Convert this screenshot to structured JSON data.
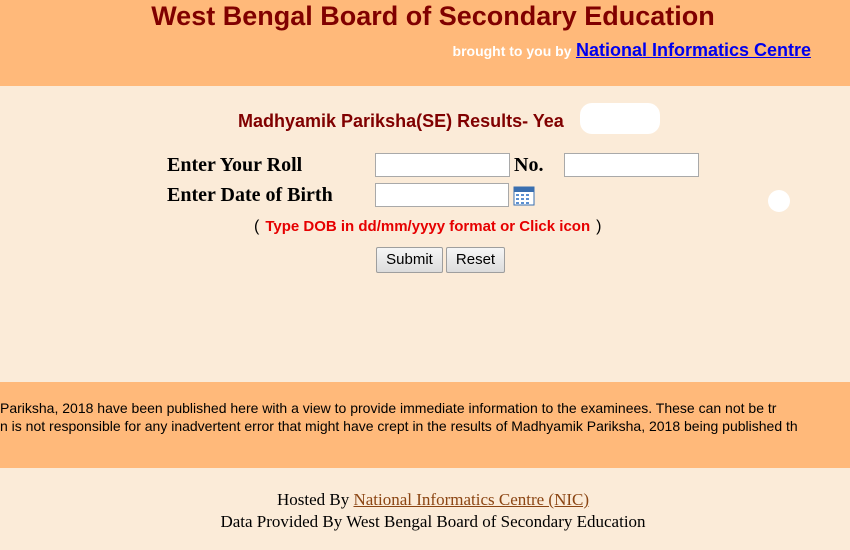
{
  "header": {
    "title": "West Bengal Board of Secondary Education",
    "brought_by": "brought to you by",
    "nic_link": "National Informatics Centre",
    "background_color": "#ffb97a",
    "title_color": "#800000"
  },
  "form": {
    "results_title": "Madhyamik Pariksha(SE) Results- Yea",
    "roll_label": "Enter Your Roll",
    "no_label": "No.",
    "dob_label": "Enter Date of Birth",
    "roll_value": "",
    "no_value": "",
    "dob_value": "",
    "dob_hint_open": "(",
    "dob_hint": "Type DOB in dd/mm/yyyy format or Click icon",
    "dob_hint_close": ")",
    "submit_label": "Submit",
    "reset_label": "Reset",
    "calendar_icon": "calendar-icon"
  },
  "notice": {
    "line1": " Pariksha, 2018 have been published here with a view to provide immediate information to the examinees. These can not be tr",
    "line2": "n is not responsible for any inadvertent error that might have crept in the results of Madhyamik Pariksha, 2018 being published th"
  },
  "footer": {
    "hosted_by": "Hosted By",
    "hosted_link": "National Informatics Centre (NIC) ",
    "data_provided": "Data Provided By West Bengal Board of Secondary Education"
  },
  "colors": {
    "page_background": "#fbebd8",
    "band_background": "#ffb97a",
    "hint_red": "#e60000",
    "link_blue": "#0000ee",
    "footer_link": "#8b4513"
  }
}
